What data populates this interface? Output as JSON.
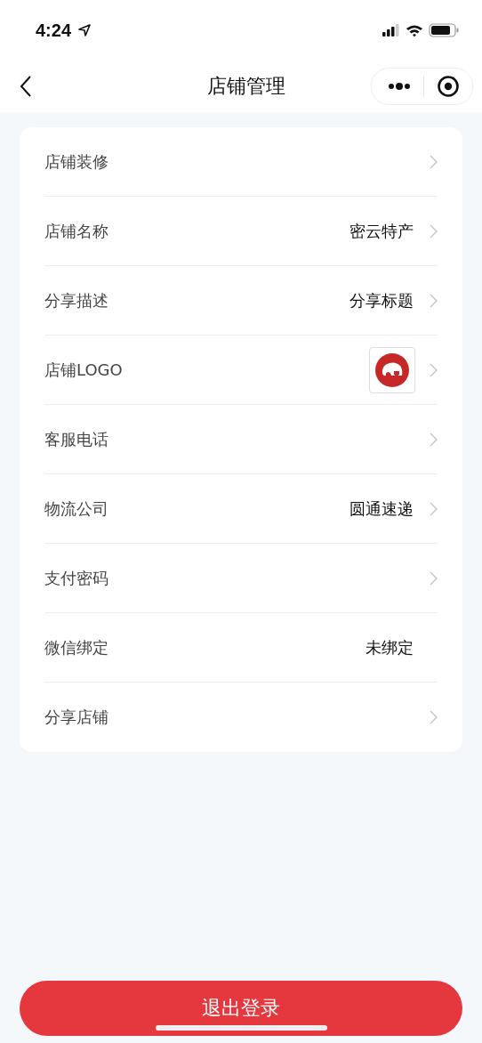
{
  "status_bar": {
    "time": "4:24"
  },
  "nav": {
    "title": "店铺管理"
  },
  "rows": [
    {
      "kind": "plain",
      "label": "店铺装修",
      "chevron": true
    },
    {
      "kind": "value",
      "label": "店铺名称",
      "value": "密云特产",
      "chevron": true
    },
    {
      "kind": "value",
      "label": "分享描述",
      "value": "分享标题",
      "chevron": true
    },
    {
      "kind": "logo",
      "label": "店铺LOGO",
      "chevron": true
    },
    {
      "kind": "plain",
      "label": "客服电话",
      "chevron": true
    },
    {
      "kind": "value",
      "label": "物流公司",
      "value": "圆通速递",
      "chevron": true
    },
    {
      "kind": "plain",
      "label": "支付密码",
      "chevron": true
    },
    {
      "kind": "value",
      "label": "微信绑定",
      "value": "未绑定",
      "chevron": false
    },
    {
      "kind": "plain",
      "label": "分享店铺",
      "chevron": true
    }
  ],
  "logout_button": "退出登录"
}
